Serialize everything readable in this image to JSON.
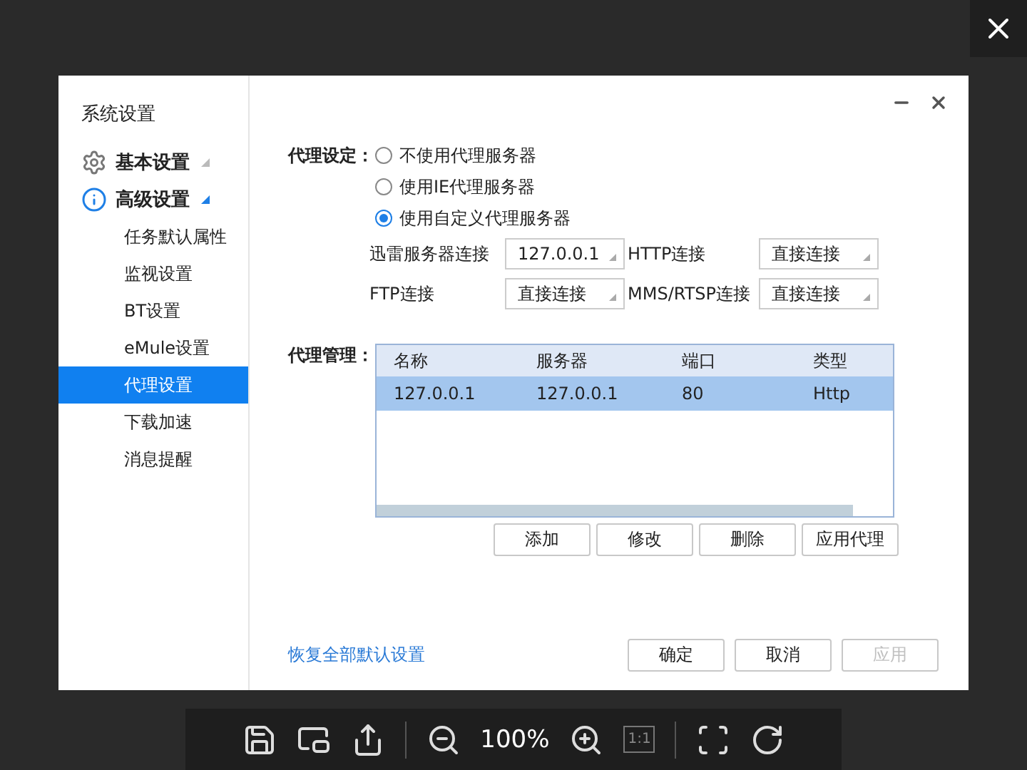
{
  "viewer": {
    "zoom": "100%",
    "actual_size": "1:1"
  },
  "dialog": {
    "title": "系统设置",
    "nav": [
      {
        "label": "基本设置",
        "kind": "gear",
        "expanded": false
      },
      {
        "label": "高级设置",
        "kind": "info",
        "expanded": true,
        "children": [
          {
            "label": "任务默认属性",
            "selected": false
          },
          {
            "label": "监视设置",
            "selected": false
          },
          {
            "label": "BT设置",
            "selected": false
          },
          {
            "label": "eMule设置",
            "selected": false
          },
          {
            "label": "代理设置",
            "selected": true
          },
          {
            "label": "下载加速",
            "selected": false
          },
          {
            "label": "消息提醒",
            "selected": false
          }
        ]
      }
    ],
    "proxy": {
      "label": "代理设定：",
      "options": [
        {
          "label": "不使用代理服务器",
          "selected": false
        },
        {
          "label": "使用IE代理服务器",
          "selected": false
        },
        {
          "label": "使用自定义代理服务器",
          "selected": true
        }
      ],
      "connections": [
        {
          "label": "迅雷服务器连接",
          "value": "127.0.0.1"
        },
        {
          "label": "HTTP连接",
          "value": "直接连接"
        },
        {
          "label": "FTP连接",
          "value": "直接连接"
        },
        {
          "label": "MMS/RTSP连接",
          "value": "直接连接"
        }
      ]
    },
    "management": {
      "label": "代理管理：",
      "columns": [
        "名称",
        "服务器",
        "端口",
        "类型"
      ],
      "rows": [
        {
          "cells": [
            "127.0.0.1",
            "127.0.0.1",
            "80",
            "Http"
          ],
          "selected": true
        }
      ],
      "buttons": [
        "添加",
        "修改",
        "删除",
        "应用代理"
      ]
    },
    "reset_link": "恢复全部默认设置",
    "buttons": [
      {
        "label": "确定",
        "disabled": false
      },
      {
        "label": "取消",
        "disabled": false
      },
      {
        "label": "应用",
        "disabled": true
      }
    ]
  }
}
